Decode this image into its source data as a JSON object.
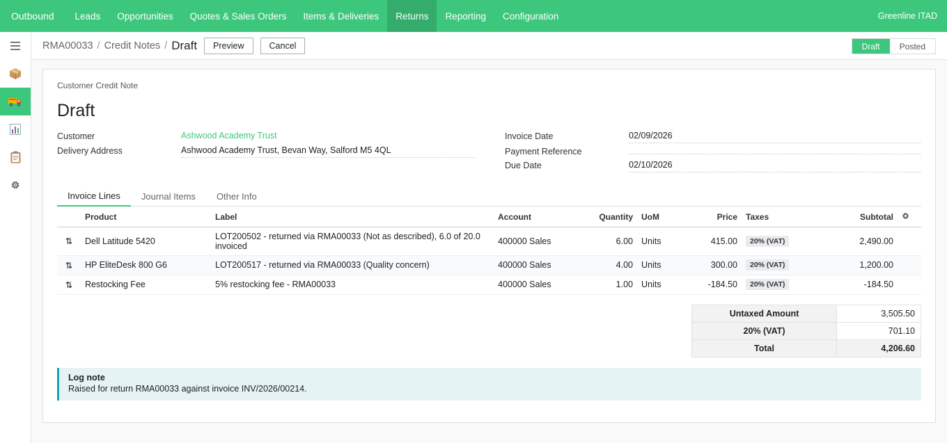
{
  "app": {
    "brand": "Outbound",
    "company": "Greenline ITAD",
    "nav": [
      {
        "label": "Leads",
        "active": false
      },
      {
        "label": "Opportunities",
        "active": false
      },
      {
        "label": "Quotes & Sales Orders",
        "active": false
      },
      {
        "label": "Items & Deliveries",
        "active": false
      },
      {
        "label": "Returns",
        "active": true
      },
      {
        "label": "Reporting",
        "active": false
      },
      {
        "label": "Configuration",
        "active": false
      }
    ],
    "accent_color": "#3cc77c"
  },
  "sidebar": {
    "items": [
      {
        "icon": "menu-icon",
        "active": false
      },
      {
        "icon": "package-icon",
        "active": false
      },
      {
        "icon": "truck-icon",
        "active": true
      },
      {
        "icon": "bar-chart-icon",
        "active": false
      },
      {
        "icon": "clipboard-icon",
        "active": false
      },
      {
        "icon": "gear-icon",
        "active": false
      }
    ]
  },
  "breadcrumb": {
    "items": [
      "RMA00033",
      "Credit Notes"
    ],
    "separator": "/",
    "current": "Draft"
  },
  "toolbar": {
    "preview_label": "Preview",
    "cancel_label": "Cancel"
  },
  "status": {
    "steps": [
      {
        "label": "Draft",
        "active": true
      },
      {
        "label": "Posted",
        "active": false
      }
    ]
  },
  "form": {
    "kind": "Customer Credit Note",
    "title": "Draft",
    "left_fields": {
      "customer_label": "Customer",
      "customer_value": "Ashwood Academy Trust",
      "delivery_label": "Delivery Address",
      "delivery_value": "Ashwood Academy Trust, Bevan Way, Salford M5 4QL"
    },
    "right_fields": {
      "invoice_date_label": "Invoice Date",
      "invoice_date_value": "02/09/2026",
      "payment_ref_label": "Payment Reference",
      "payment_ref_value": "",
      "due_date_label": "Due Date",
      "due_date_value": "02/10/2026"
    }
  },
  "tabs": [
    {
      "label": "Invoice Lines",
      "active": true
    },
    {
      "label": "Journal Items",
      "active": false
    },
    {
      "label": "Other Info",
      "active": false
    }
  ],
  "lines": {
    "columns": {
      "product": "Product",
      "label": "Label",
      "account": "Account",
      "quantity": "Quantity",
      "uom": "UoM",
      "price": "Price",
      "taxes": "Taxes",
      "subtotal": "Subtotal"
    },
    "rows": [
      {
        "product": "Dell Latitude 5420",
        "label": "LOT200502 - returned via RMA00033 (Not as described), 6.0 of 20.0 invoiced",
        "account": "400000 Sales",
        "quantity": "6.00",
        "uom": "Units",
        "price": "415.00",
        "tax": "20% (VAT)",
        "subtotal": "2,490.00"
      },
      {
        "product": "HP EliteDesk 800 G6",
        "label": "LOT200517 - returned via RMA00033 (Quality concern)",
        "account": "400000 Sales",
        "quantity": "4.00",
        "uom": "Units",
        "price": "300.00",
        "tax": "20% (VAT)",
        "subtotal": "1,200.00"
      },
      {
        "product": "Restocking Fee",
        "label": "5% restocking fee - RMA00033",
        "account": "400000 Sales",
        "quantity": "1.00",
        "uom": "Units",
        "price": "-184.50",
        "tax": "20% (VAT)",
        "subtotal": "-184.50"
      }
    ]
  },
  "totals": {
    "untaxed_label": "Untaxed Amount",
    "untaxed_value": "3,505.50",
    "tax_label": "20% (VAT)",
    "tax_value": "701.10",
    "total_label": "Total",
    "total_value": "4,206.60"
  },
  "log_note": {
    "title": "Log note",
    "body": "Raised for return RMA00033 against invoice INV/2026/00214."
  }
}
